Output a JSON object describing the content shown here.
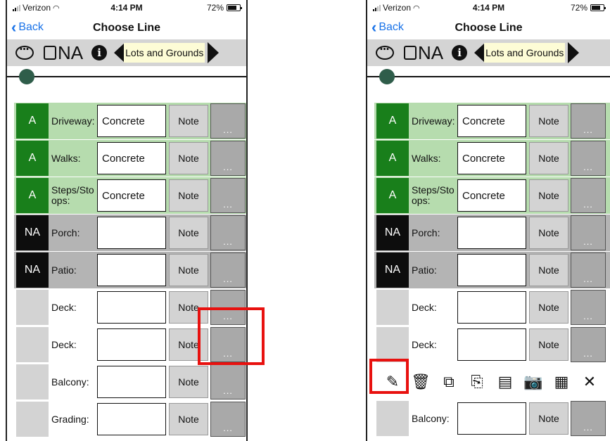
{
  "status": {
    "carrier": "Verizon",
    "time": "4:14 PM",
    "battery": "72%"
  },
  "nav": {
    "back_label": "Back",
    "title": "Choose Line"
  },
  "toolbar": {
    "na_label": "NA",
    "section": "Lots and Grounds"
  },
  "slider": {
    "value": 0.0
  },
  "note_label": "Note",
  "more_label": "...",
  "left_rows": [
    {
      "rating": "A",
      "label": "Driveway:",
      "value": "Concrete"
    },
    {
      "rating": "A",
      "label": "Walks:",
      "value": "Concrete"
    },
    {
      "rating": "A",
      "label": "Steps/Stoops:",
      "value": "Concrete"
    },
    {
      "rating": "NA",
      "label": "Porch:",
      "value": ""
    },
    {
      "rating": "NA",
      "label": "Patio:",
      "value": ""
    },
    {
      "rating": "",
      "label": "Deck:",
      "value": ""
    },
    {
      "rating": "",
      "label": "Deck:",
      "value": ""
    },
    {
      "rating": "",
      "label": "Balcony:",
      "value": ""
    },
    {
      "rating": "",
      "label": "Grading:",
      "value": ""
    }
  ],
  "right_rows": [
    {
      "rating": "A",
      "label": "Driveway:",
      "value": "Concrete"
    },
    {
      "rating": "A",
      "label": "Walks:",
      "value": "Concrete"
    },
    {
      "rating": "A",
      "label": "Steps/Stoops:",
      "value": "Concrete"
    },
    {
      "rating": "NA",
      "label": "Porch:",
      "value": ""
    },
    {
      "rating": "NA",
      "label": "Patio:",
      "value": ""
    },
    {
      "rating": "",
      "label": "Deck:",
      "value": ""
    },
    {
      "rating": "",
      "label": "Deck:",
      "value": ""
    },
    {
      "rating": "",
      "label": "Balcony:",
      "value": ""
    }
  ],
  "action_bar": {
    "icons": [
      "edit-icon",
      "trash-icon",
      "copy-icon",
      "paste-icon",
      "template-icon",
      "camera-icon",
      "video-icon",
      "close-icon"
    ],
    "glyphs": [
      "✎",
      "🗑",
      "⧉",
      "⎘",
      "▤",
      "📷",
      "▦",
      "✕"
    ]
  },
  "colors": {
    "rating_a": "#197f1b",
    "rating_a_row": "#b6dcae",
    "rating_na": "#0d0d0d",
    "rating_na_row": "#b4b4b4",
    "highlight": "#e8110f",
    "accent": "#1a73e8"
  }
}
